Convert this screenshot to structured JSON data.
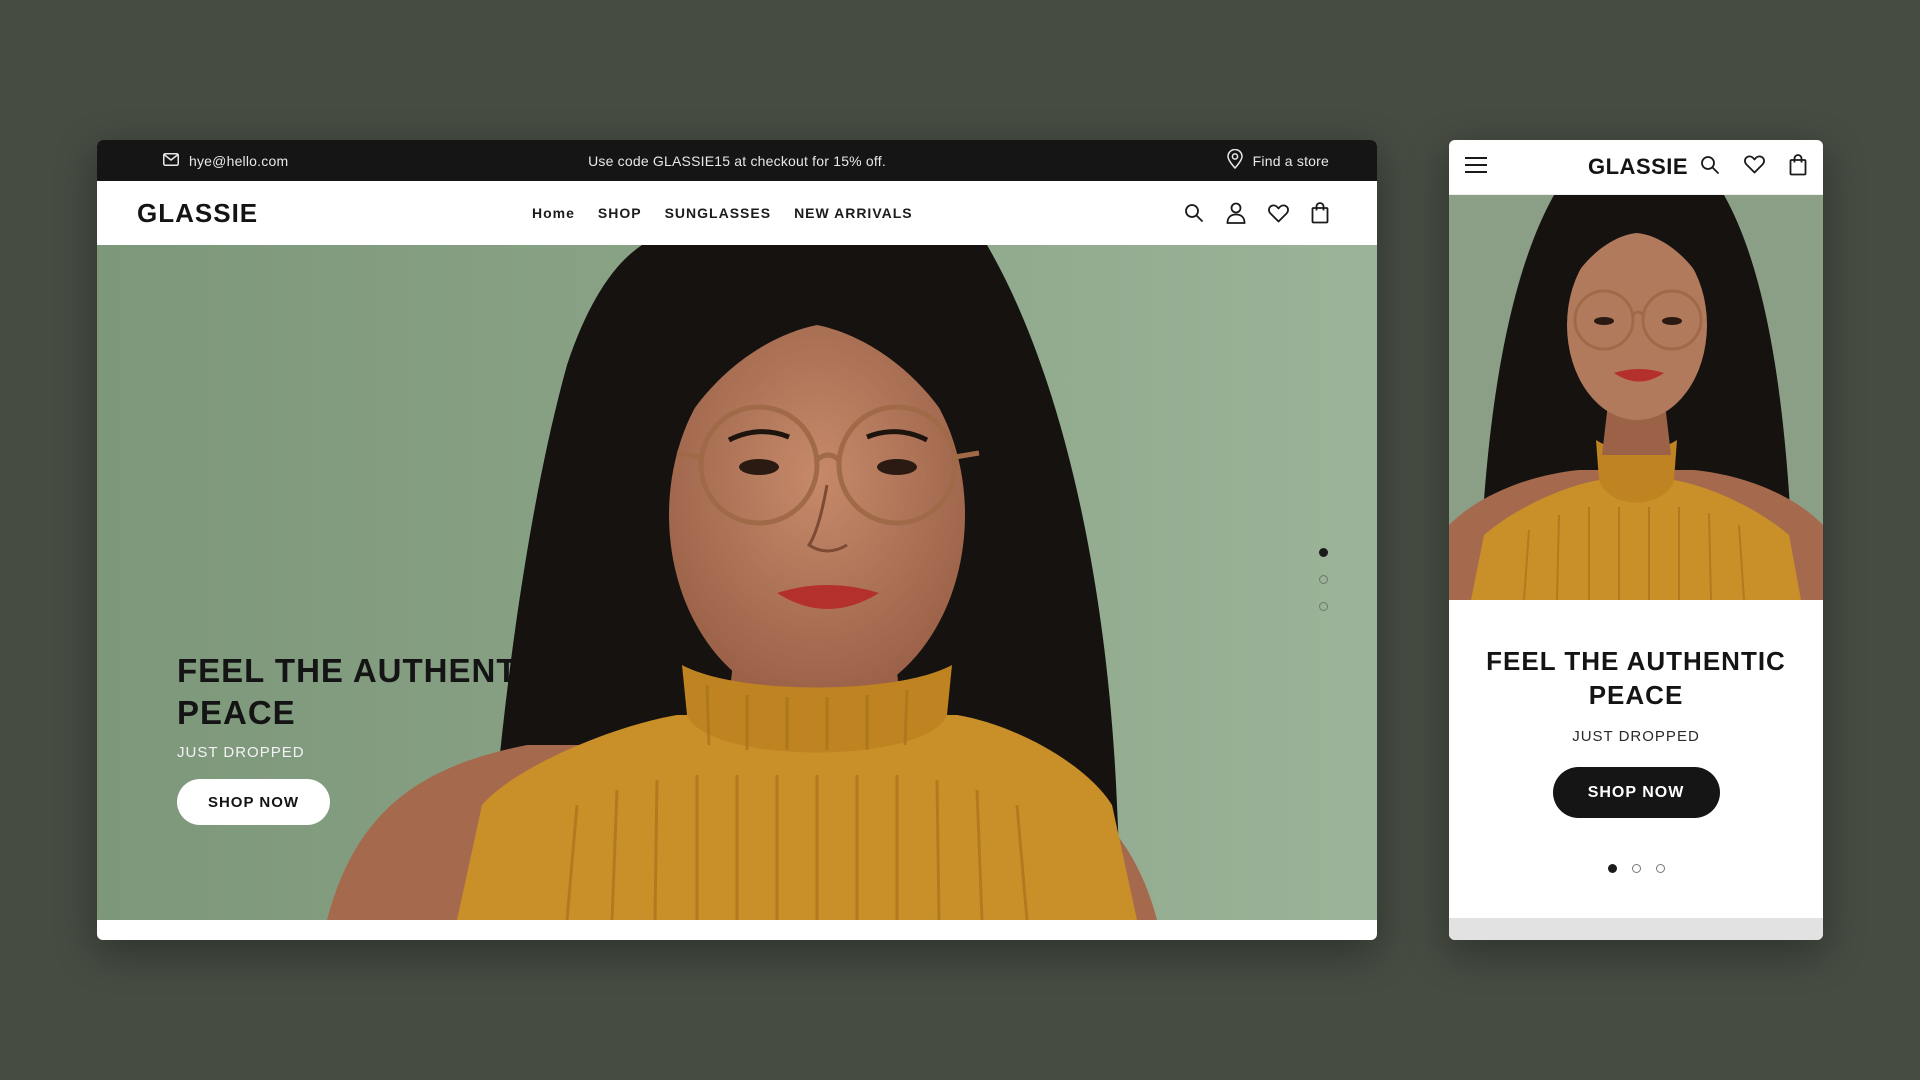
{
  "desktop": {
    "announce": {
      "email": "hye@hello.com",
      "promo": "Use code GLASSIE15 at checkout for 15% off.",
      "store_link": "Find a store"
    },
    "nav": {
      "logo": "GLASSIE",
      "links": [
        "Home",
        "SHOP",
        "SUNGLASSES",
        "NEW ARRIVALS"
      ],
      "icons": [
        "search-icon",
        "account-icon",
        "heart-icon",
        "bag-icon"
      ]
    },
    "hero": {
      "title": "FEEL THE AUTHENT\nPEACE",
      "subtitle": "JUST DROPPED",
      "button": "SHOP NOW",
      "slides": 3,
      "active_slide": 1
    }
  },
  "mobile": {
    "header": {
      "logo": "GLASSIE",
      "icons": [
        "menu-icon",
        "search-icon",
        "heart-icon",
        "bag-icon"
      ]
    },
    "hero": {
      "title": "FEEL THE AUTHENTIC\nPEACE",
      "subtitle": "JUST DROPPED",
      "button": "SHOP NOW",
      "slides": 3,
      "active_slide": 1
    }
  },
  "colors": {
    "background": "#464c42",
    "hero_green": "#8ea58a",
    "sweater": "#c98f28",
    "ink": "#141414"
  }
}
